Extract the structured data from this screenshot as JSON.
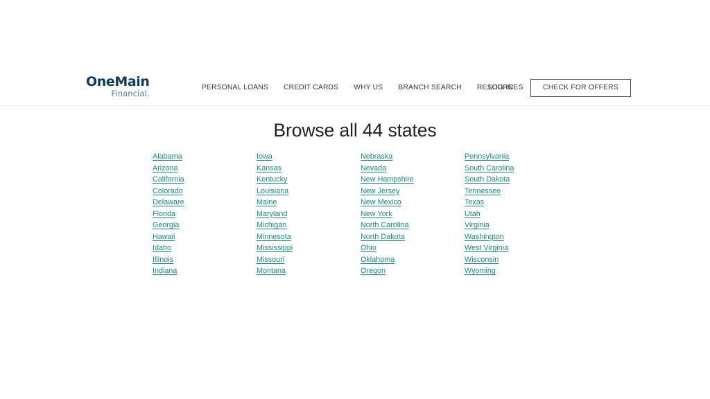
{
  "header": {
    "logo": {
      "name": "OneMain",
      "tagline": "Financial."
    },
    "nav_items": [
      {
        "label": "PERSONAL LOANS"
      },
      {
        "label": "CREDIT CARDS"
      },
      {
        "label": "WHY US"
      },
      {
        "label": "BRANCH SEARCH"
      },
      {
        "label": "RESOURCES"
      }
    ],
    "login_label": "LOG IN",
    "cta_label": "CHECK FOR OFFERS"
  },
  "main": {
    "title": "Browse all 44 states",
    "state_count": 44,
    "columns": [
      {
        "states": [
          "Alabama",
          "Arizona",
          "California",
          "Colorado",
          "Delaware",
          "Florida",
          "Georgia",
          "Hawaii",
          "Idaho",
          "Illinois",
          "Indiana"
        ]
      },
      {
        "states": [
          "Iowa",
          "Kansas",
          "Kentucky",
          "Louisiana",
          "Maine",
          "Maryland",
          "Michigan",
          "Minnesota",
          "Mississippi",
          "Missouri",
          "Montana"
        ]
      },
      {
        "states": [
          "Nebraska",
          "Nevada",
          "New Hampshire",
          "New Jersey",
          "New Mexico",
          "New York",
          "North Carolina",
          "North Dakota",
          "Ohio",
          "Oklahoma",
          "Oregon"
        ]
      },
      {
        "states": [
          "Pennsylvania",
          "South Carolina",
          "South Dakota",
          "Tennessee",
          "Texas",
          "Utah",
          "Virginia",
          "Washington",
          "West Virginia",
          "Wisconsin",
          "Wyoming"
        ]
      }
    ]
  },
  "colors": {
    "link_teal": "#1c8a7d",
    "logo_navy": "#0e3a5c",
    "logo_blue": "#4a7d9b",
    "text_dark": "#333333",
    "title_dark": "#222222",
    "border_light": "#eceef0",
    "button_border": "#4a4a4a",
    "background": "#ffffff"
  }
}
